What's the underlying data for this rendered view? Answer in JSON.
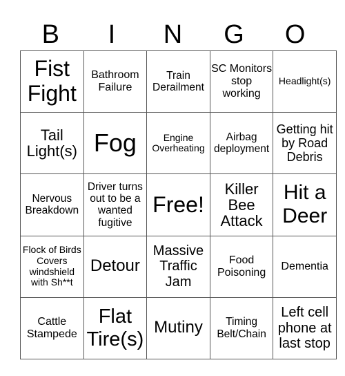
{
  "header": {
    "letters": [
      "B",
      "I",
      "N",
      "G",
      "O"
    ]
  },
  "grid": {
    "rows": [
      [
        "Fist Fight",
        "Bathroom Failure",
        "Train Derailment",
        "SC Monitors stop working",
        "Headlight(s)"
      ],
      [
        "Tail Light(s)",
        "Fog",
        "Engine Overheating",
        "Airbag deployment",
        "Getting hit by Road Debris"
      ],
      [
        "Nervous Breakdown",
        "Driver turns out to be a wanted fugitive",
        "Free!",
        "Killer Bee Attack",
        "Hit a Deer"
      ],
      [
        "Flock of Birds Covers windshield with Sh**t",
        "Detour",
        "Massive Traffic Jam",
        "Food Poisoning",
        "Dementia"
      ],
      [
        "Cattle Stampede",
        "Flat Tire(s)",
        "Mutiny",
        "Timing Belt/Chain",
        "Left cell phone at last stop"
      ]
    ]
  }
}
